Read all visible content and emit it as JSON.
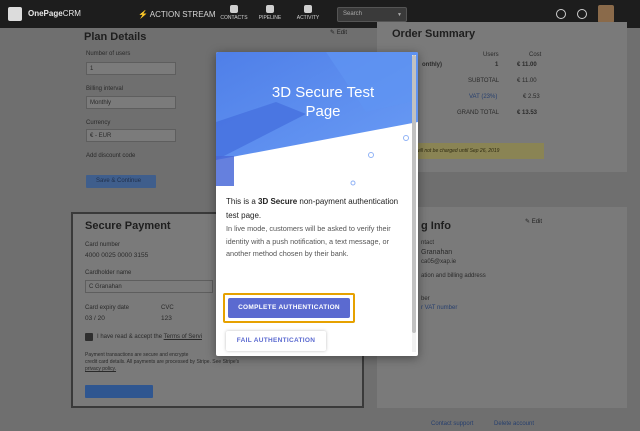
{
  "topbar": {
    "logo": "OnePage",
    "logo_suffix": "CRM",
    "action_stream": "ACTION STREAM",
    "nav": [
      "CONTACTS",
      "PIPELINE",
      "ACTIVITY"
    ],
    "search_placeholder": "Search"
  },
  "plan": {
    "title": "Plan Details",
    "edit": "Edit",
    "number_of_users_label": "Number of users",
    "number_of_users_value": "1",
    "billing_interval_label": "Billing interval",
    "billing_interval_value": "Monthly",
    "currency_label": "Currency",
    "currency_value": "€ - EUR",
    "add_discount": "Add discount code",
    "save_button": "Save & Continue"
  },
  "secure_payment": {
    "title": "Secure Payment",
    "card_number_label": "Card number",
    "card_number_value": "4000 0025 0000 3155",
    "cardholder_label": "Cardholder name",
    "cardholder_value": "C Granahan",
    "expiry_label": "Card expiry date",
    "expiry_value": "03 / 20",
    "cvc_label": "CVC",
    "cvc_value": "123",
    "terms_text": "I have read & accept the",
    "terms_link": "Terms of Servi",
    "disclaimer_1": "Payment transactions are secure and encrypte",
    "disclaimer_2": "credit card details. All payments are processed by Stripe. See Stripe's",
    "disclaimer_3": "privacy policy."
  },
  "order_summary": {
    "title": "Order Summary",
    "col_users": "Users",
    "col_cost": "Cost",
    "row_label": "onthly)",
    "row_users": "1",
    "row_cost": "€ 11.00",
    "subtotal_label": "SUBTOTAL",
    "subtotal_value": "€ 11.00",
    "vat_label": "VAT (23%)",
    "vat_value": "€ 2.53",
    "grand_total_label": "GRAND TOTAL",
    "grand_total_value": "€ 13.53",
    "note": "will not be charged until Sep 26, 2019"
  },
  "billing_info": {
    "title": "g Info",
    "edit": "Edit",
    "line1": "ntact",
    "line2": "Granahan",
    "line3": "ca05@xap.ie",
    "line4": "ation and billing address",
    "line5": "ber",
    "line6": "r VAT number"
  },
  "modal": {
    "hero_title": "3D Secure Test Page",
    "lead_pre": "This is a ",
    "lead_bold": "3D Secure",
    "lead_post": " non-payment authentication test page.",
    "sub": "In live mode, customers will be asked to verify their identity with a push notification, a text message, or another method chosen by their bank.",
    "complete_button": "COMPLETE AUTHENTICATION",
    "fail_button": "FAIL AUTHENTICATION"
  },
  "footer": {
    "contact_support": "Contact support",
    "delete_account": "Delete account"
  },
  "colors": {
    "accent": "#5b6ad0",
    "highlight": "#e6a100",
    "hero_blue": "#5b8cf0"
  }
}
